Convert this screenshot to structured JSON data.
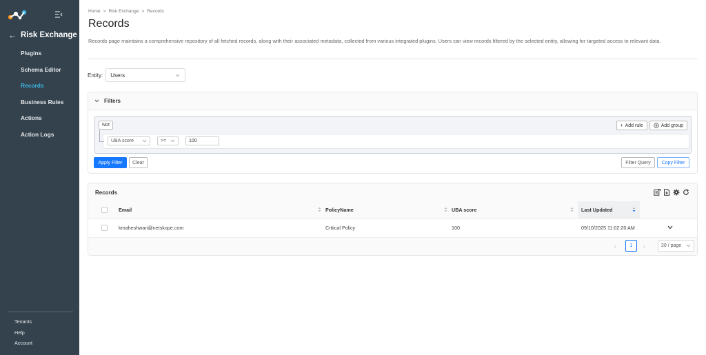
{
  "sidebar": {
    "section_title": "Risk Exchange",
    "items": [
      {
        "label": "Plugins",
        "active": false
      },
      {
        "label": "Schema Editor",
        "active": false
      },
      {
        "label": "Records",
        "active": true
      },
      {
        "label": "Business Rules",
        "active": false
      },
      {
        "label": "Actions",
        "active": false
      },
      {
        "label": "Action Logs",
        "active": false
      }
    ],
    "bottom_links": [
      "Tenants",
      "Help",
      "Account"
    ]
  },
  "breadcrumb": [
    "Home",
    "Risk Exchange",
    "Records"
  ],
  "breadcrumb_separator": ">",
  "page": {
    "title": "Records",
    "description": "Records page maintains a comprehensive repository of all fetched records, along with their associated metadata, collected from various integrated plugins. Users can view records filtered by the selected entity, allowing for targeted access to relevant data."
  },
  "entity": {
    "label": "Entity:",
    "value": "Users"
  },
  "filters": {
    "title": "Filters",
    "not_label": "Not",
    "add_rule_label": "Add rule",
    "add_group_label": "Add group",
    "rule": {
      "field": "UBA score",
      "operator": ">=",
      "value": "100"
    },
    "apply_label": "Apply Filter",
    "clear_label": "Clear",
    "filter_query_label": "Filter Query",
    "copy_filter_label": "Copy Filter"
  },
  "records": {
    "title": "Records",
    "columns": [
      "Email",
      "PolicyName",
      "UBA score",
      "Last Updated"
    ],
    "rows": [
      {
        "email": "kmaheshwari@netskope.com",
        "policy": "Critical Policy",
        "uba": "100",
        "updated": "09/10/2025 11:02:20 AM"
      }
    ],
    "pagination": {
      "current": "1",
      "page_size": "20 / page"
    }
  },
  "colors": {
    "sidebar_bg": "#33424d",
    "accent": "#3fb6e6",
    "primary": "#1677ff"
  }
}
